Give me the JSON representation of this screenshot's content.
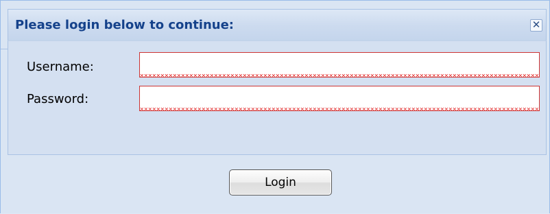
{
  "dialog": {
    "title": "Please login below to continue:",
    "close_label": "✕"
  },
  "form": {
    "username_label": "Username:",
    "username_value": "",
    "password_label": "Password:",
    "password_value": ""
  },
  "actions": {
    "login_label": "Login"
  },
  "colors": {
    "title_text": "#15428b",
    "panel_bg": "#d4e0f1",
    "invalid_border": "#cc3333"
  }
}
